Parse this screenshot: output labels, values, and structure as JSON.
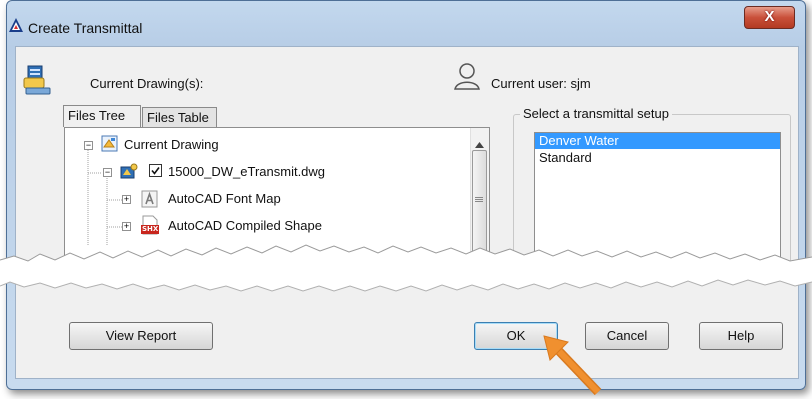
{
  "window": {
    "title": "Create Transmittal",
    "close_symbol": "X"
  },
  "header": {
    "current_drawings_label": "Current Drawing(s):",
    "current_user_label": "Current user: sjm"
  },
  "tabs": [
    {
      "label": "Files Tree",
      "active": true
    },
    {
      "label": "Files Table",
      "active": false
    }
  ],
  "tree": {
    "items": [
      {
        "label": "Current Drawing",
        "expander": "−",
        "checkbox": false,
        "icon": "drawing-sheet-icon"
      },
      {
        "label": "15000_DW_eTransmit.dwg",
        "expander": "−",
        "checkbox": true,
        "checked": true,
        "icon": "dwg-file-icon"
      },
      {
        "label": "AutoCAD Font Map",
        "expander": "+",
        "checkbox": false,
        "icon": "font-map-icon"
      },
      {
        "label": "AutoCAD Compiled Shape",
        "expander": "+",
        "checkbox": false,
        "icon": "shx-file-icon"
      }
    ],
    "shx_badge": "SHX"
  },
  "setups": {
    "legend": "Select a transmittal setup",
    "options": [
      "Denver Water",
      "Standard"
    ],
    "selected": "Denver Water"
  },
  "buttons": {
    "view_report": "View Report",
    "ok": "OK",
    "cancel": "Cancel",
    "help": "Help"
  },
  "colors": {
    "selection": "#3399ff",
    "callout_arrow": "#f0902f",
    "close_button": "#c9503a"
  },
  "icons": {
    "title": "autocad-logo-icon",
    "drawings": "transmittal-package-icon",
    "user": "user-silhouette-icon",
    "callout": "orange-arrow-icon"
  }
}
